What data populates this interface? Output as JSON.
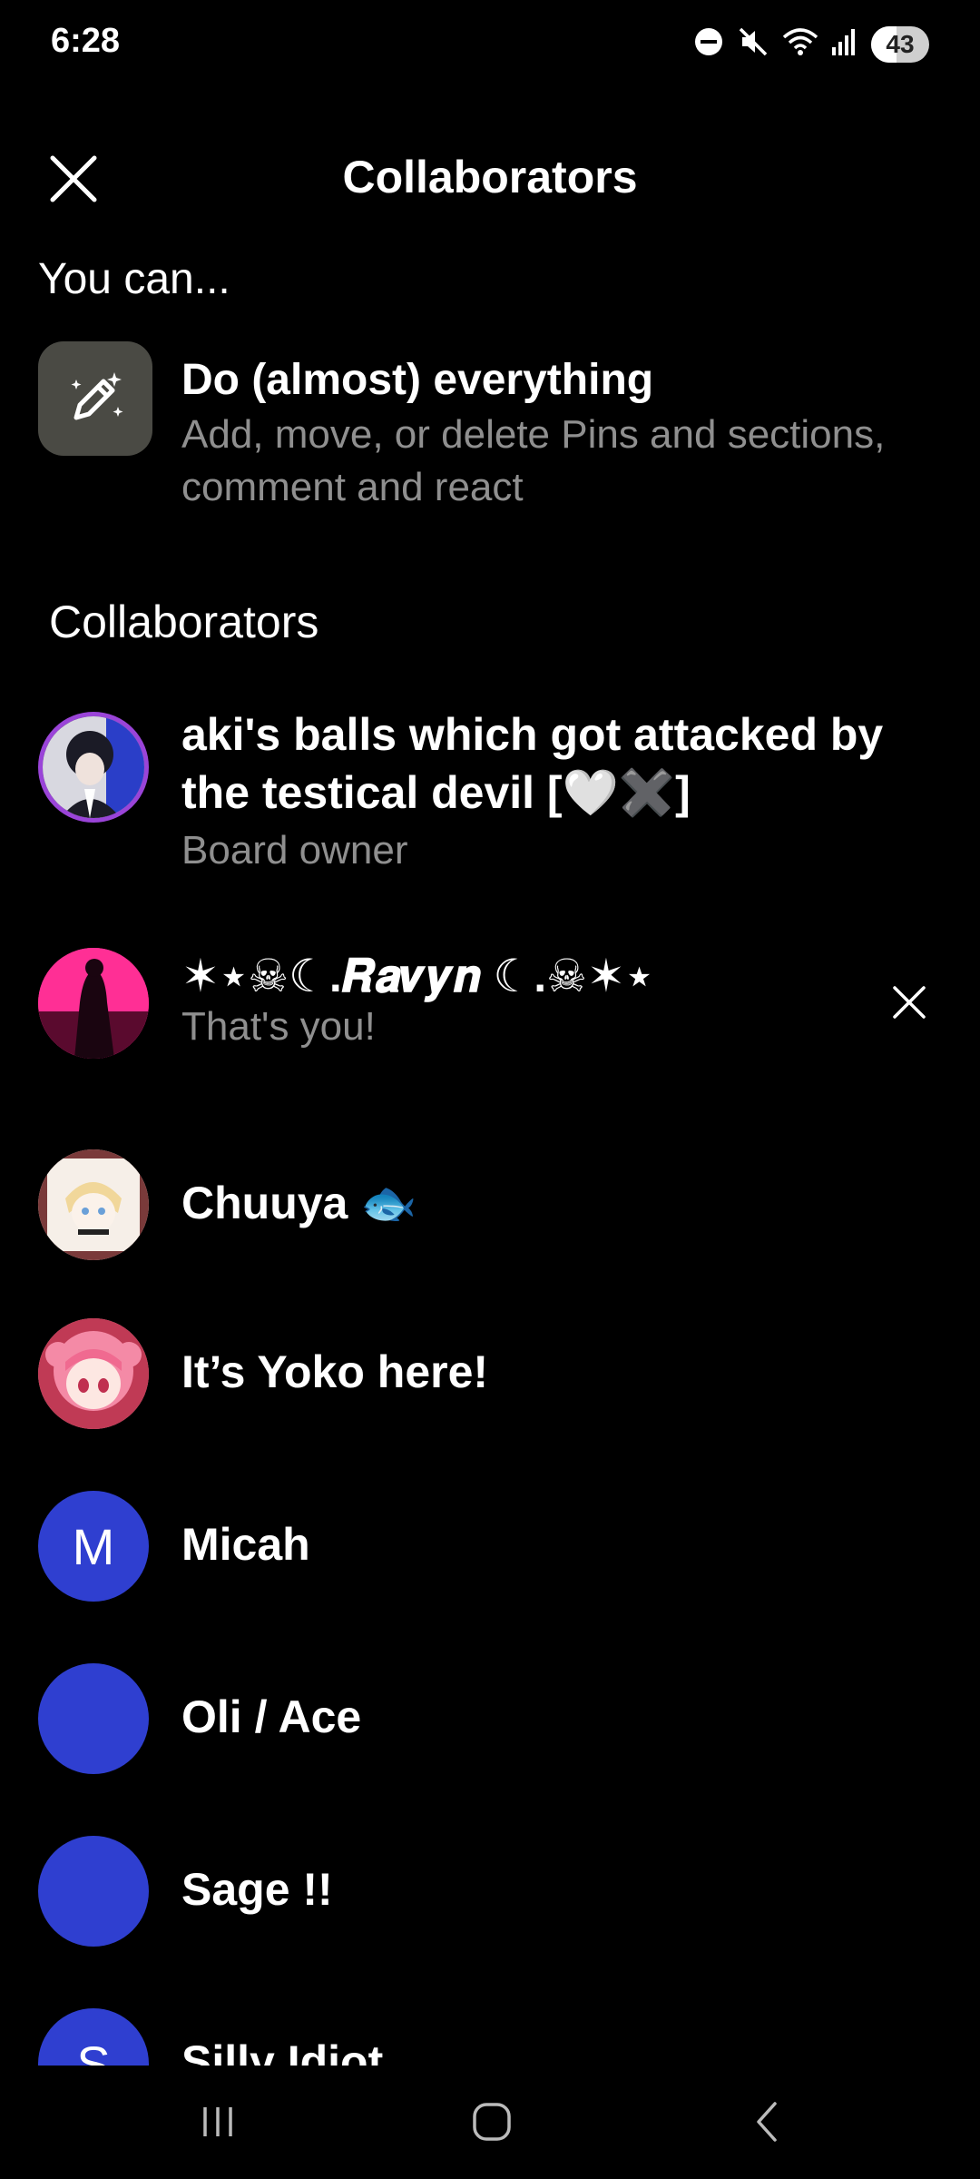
{
  "status_bar": {
    "time": "6:28",
    "battery": "43",
    "battery_level": 0.43,
    "icons": [
      "dnd-icon",
      "mute-icon",
      "wifi-icon",
      "signal-icon",
      "battery-icon"
    ]
  },
  "header": {
    "title": "Collaborators",
    "close_icon": "close-icon"
  },
  "permissions": {
    "heading": "You can...",
    "title": "Do (almost) everything",
    "description": "Add, move, or delete Pins and sections, comment and react",
    "icon": "magic-pen-icon"
  },
  "collaborators": {
    "heading": "Collaborators",
    "items": [
      {
        "name": "aki's balls which got attacked by the testical devil [🤍✖️]",
        "subtitle": "Board owner",
        "avatar": "photo"
      },
      {
        "name": "✶⋆☠︎☾.𝑹𝒂𝒗𝒚𝒏 ☾.☠︎✶⋆",
        "subtitle": "That's you!",
        "avatar": "photo"
      },
      {
        "name": "Chuuya 🐟",
        "subtitle": "",
        "avatar": "photo"
      },
      {
        "name": "It’s Yoko here!",
        "subtitle": "",
        "avatar": "photo"
      },
      {
        "name": "Micah",
        "subtitle": "",
        "avatar": "M"
      },
      {
        "name": "Oli / Ace",
        "subtitle": "",
        "avatar": ""
      },
      {
        "name": "Sage !!",
        "subtitle": "",
        "avatar": ""
      },
      {
        "name": "Silly Idiot",
        "subtitle": "",
        "avatar": "S"
      }
    ]
  },
  "nav_bar": {
    "buttons": [
      "recent-apps-icon",
      "home-icon",
      "back-icon"
    ]
  },
  "colors": {
    "background": "#000000",
    "text_primary": "#ffffff",
    "text_secondary": "#8f8f8f",
    "avatar_blue": "#2f3fd0",
    "perm_icon_bg": "#4a4a44"
  }
}
